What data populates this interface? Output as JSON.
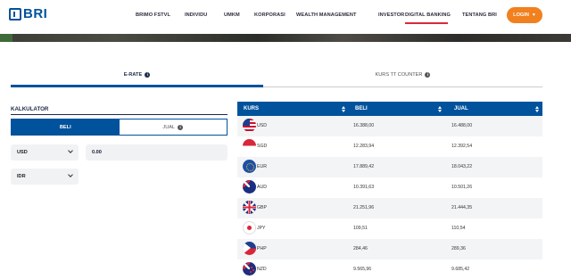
{
  "brand": {
    "name": "BRI"
  },
  "nav": {
    "items": [
      {
        "label": "BRIMO FSTVL"
      },
      {
        "label": "INDIVIDU"
      },
      {
        "label": "UMKM"
      },
      {
        "label": "KORPORASI"
      },
      {
        "label": "WEALTH MANAGEMENT"
      },
      {
        "label": "INVESTOR"
      },
      {
        "label": "DIGITAL BANKING",
        "active": true
      },
      {
        "label": "TENTANG BRI"
      }
    ],
    "login_label": "LOGIN"
  },
  "tabs": [
    {
      "label": "E-RATE",
      "active": true
    },
    {
      "label": "KURS TT COUNTER",
      "active": false
    }
  ],
  "calculator": {
    "title": "KALKULATOR",
    "mode_buy": "BELI",
    "mode_sell": "JUAL",
    "from_currency": "USD",
    "to_currency": "IDR",
    "amount": "0.00"
  },
  "rates": {
    "headers": {
      "kurs": "KURS",
      "beli": "BELI",
      "jual": "JUAL"
    },
    "rows": [
      {
        "code": "USD",
        "flag": "us-flag-icon",
        "beli": "16.388,00",
        "jual": "16.488,00"
      },
      {
        "code": "SGD",
        "flag": "sg-flag-icon",
        "beli": "12.283,94",
        "jual": "12.392,54"
      },
      {
        "code": "EUR",
        "flag": "eu-flag-icon",
        "beli": "17.889,42",
        "jual": "18.043,22"
      },
      {
        "code": "AUD",
        "flag": "au-flag-icon",
        "beli": "10.391,63",
        "jual": "10.501,26"
      },
      {
        "code": "GBP",
        "flag": "gb-flag-icon",
        "beli": "21.251,96",
        "jual": "21.444,35"
      },
      {
        "code": "JPY",
        "flag": "jp-flag-icon",
        "beli": "109,51",
        "jual": "110,54"
      },
      {
        "code": "PHP",
        "flag": "ph-flag-icon",
        "beli": "284,46",
        "jual": "289,36"
      },
      {
        "code": "NZD",
        "flag": "nz-flag-icon",
        "beli": "9.565,96",
        "jual": "9.685,42"
      }
    ]
  },
  "colors": {
    "primary": "#00529c",
    "accent": "#f1801f",
    "active_underline": "#d9293d"
  }
}
